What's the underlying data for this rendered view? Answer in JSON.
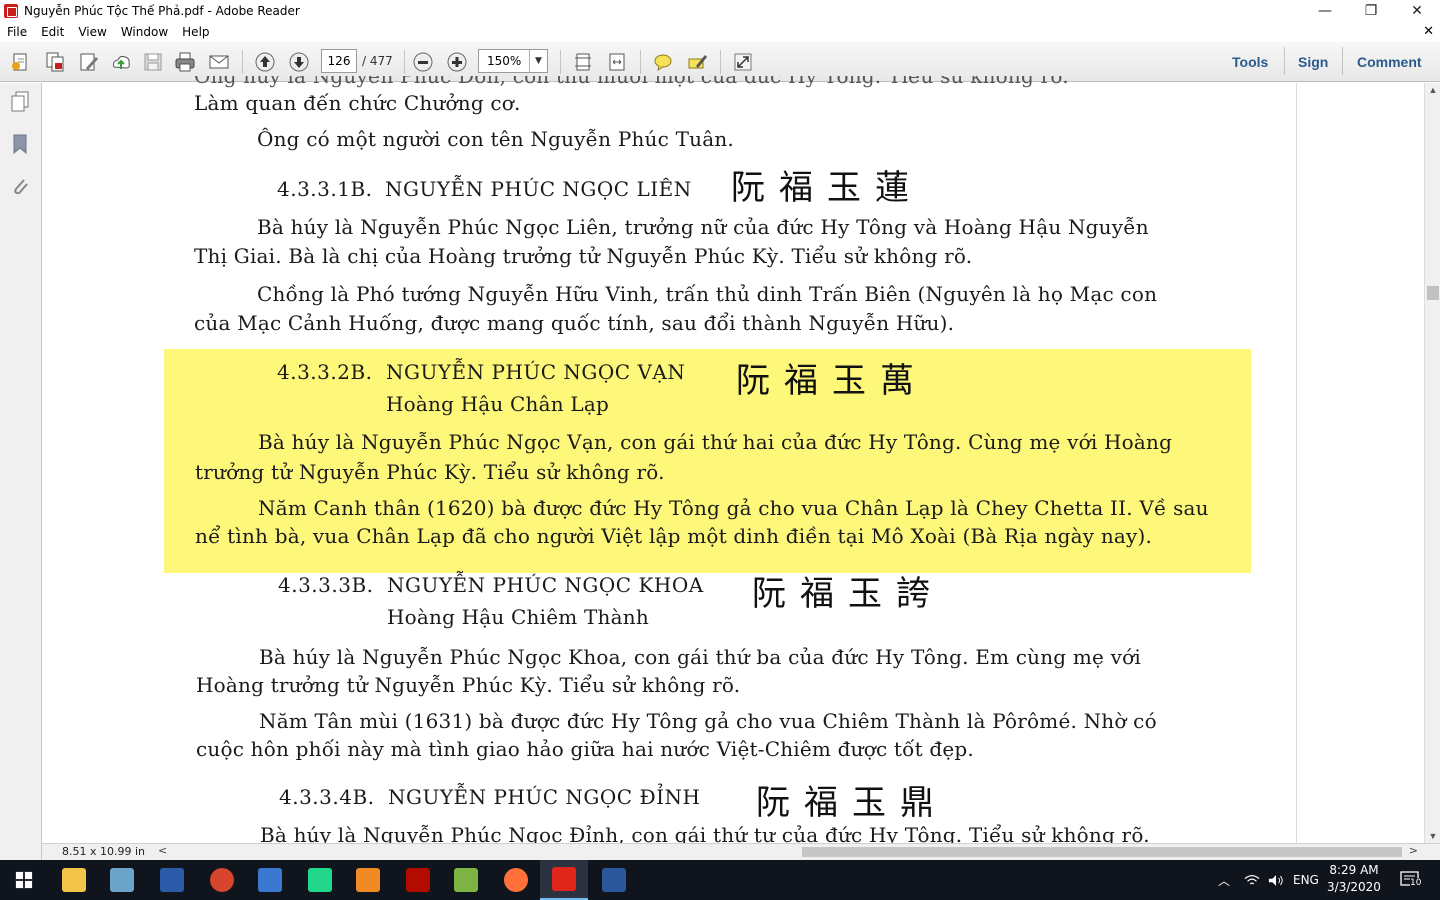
{
  "window": {
    "title": "Nguyễn Phúc Tộc Thế Phả.pdf - Adobe Reader",
    "minimize": "—",
    "maximize": "❐",
    "close": "✕"
  },
  "menu": {
    "items": [
      "File",
      "Edit",
      "View",
      "Window",
      "Help"
    ],
    "doc_close": "✕"
  },
  "toolbar": {
    "current_page": "126",
    "total_pages": "/ 477",
    "zoom": "150%",
    "zoom_arrow": "▼",
    "tools_label": "Tools",
    "sign_label": "Sign",
    "comment_label": "Comment",
    "icons": [
      "create-pdf-icon",
      "combine-icon",
      "edit-icon",
      "upload-icon",
      "save-icon",
      "print-icon",
      "email-icon",
      "previous-page-icon",
      "next-page-icon",
      "zoom-out-icon",
      "zoom-in-icon",
      "fit-page-icon",
      "fit-width-icon",
      "sticky-note-icon",
      "highlight-icon",
      "fullscreen-icon"
    ]
  },
  "document": {
    "lines": [
      "Ông húy là Nguyễn Phúc Đôn, con thứ mười một của đức Hy Tông. Tiểu sử không rõ.",
      "Làm quan đến chức Chưởng cơ.",
      "Ông có một người con tên Nguyễn Phúc Tuân.",
      "Bà húy là Nguyễn Phúc Ngọc Liên, trưởng nữ của đức Hy Tông và Hoàng Hậu Nguyễn",
      "Thị Giai. Bà là chị của Hoàng trưởng tử Nguyễn Phúc Kỳ. Tiểu sử không rõ.",
      "Chồng là Phó tướng Nguyễn Hữu Vinh, trấn thủ dinh Trấn Biên (Nguyên là họ Mạc con",
      "của Mạc Cảnh Huống, được mang quốc tính, sau đổi thành Nguyễn Hữu).",
      "Bà húy là Nguyễn Phúc Ngọc Vạn, con gái thứ hai của đức Hy Tông. Cùng mẹ với Hoàng",
      "trưởng tử Nguyễn Phúc Kỳ. Tiểu sử không rõ.",
      "Năm Canh thân (1620) bà được đức Hy Tông gả cho vua Chân Lạp là Chey Chetta II. Về sau",
      "nể tình bà, vua Chân Lạp đã cho người Việt lập một dinh điền tại Mô Xoài (Bà Rịa ngày nay).",
      "Bà húy là Nguyễn Phúc Ngọc Khoa, con gái thứ ba của đức Hy Tông. Em cùng mẹ với",
      "Hoàng trưởng tử Nguyễn Phúc Kỳ. Tiểu sử không rõ.",
      "Năm Tân mùi (1631) bà được đức Hy Tông gả cho vua Chiêm Thành là Pôrômé. Nhờ có",
      "cuộc hôn phối này mà tình giao hảo giữa hai nước Việt-Chiêm được tốt đẹp.",
      "Bà húy là Nguyễn Phúc Ngọc Đỉnh, con gái thứ tư của đức Hy Tông. Tiểu sử không rõ."
    ],
    "sections": [
      {
        "number": "4.3.3.1B.",
        "name": "NGUYỄN PHÚC NGỌC LIÊN",
        "han": "阮福玉蓮",
        "subtitle": ""
      },
      {
        "number": "4.3.3.2B.",
        "name": "NGUYỄN PHÚC NGỌC VẠN",
        "han": "阮福玉萬",
        "subtitle": "Hoàng Hậu Chân Lạp"
      },
      {
        "number": "4.3.3.3B.",
        "name": "NGUYỄN PHÚC NGỌC KHOA",
        "han": "阮福玉誇",
        "subtitle": "Hoàng Hậu Chiêm Thành"
      },
      {
        "number": "4.3.3.4B.",
        "name": "NGUYỄN PHÚC NGỌC ĐỈNH",
        "han": "阮福玉鼎",
        "subtitle": ""
      }
    ],
    "highlight_color": "#fdf77a"
  },
  "status": {
    "page_size": "8.51 x 10.99 in",
    "scroll_left": "<",
    "scroll_right": ">"
  },
  "taskbar": {
    "apps": [
      "file-explorer-icon",
      "notes-app-icon",
      "powershell-icon",
      "settings-app-icon",
      "task-app-icon",
      "pycharm-icon",
      "sublime-text-icon",
      "acrobat-dc-icon",
      "editor-app-icon",
      "firefox-icon",
      "adobe-reader-icon",
      "word-icon"
    ],
    "language": "ENG",
    "time": "8:29 AM",
    "date": "3/3/2020",
    "notification_count": "10"
  }
}
